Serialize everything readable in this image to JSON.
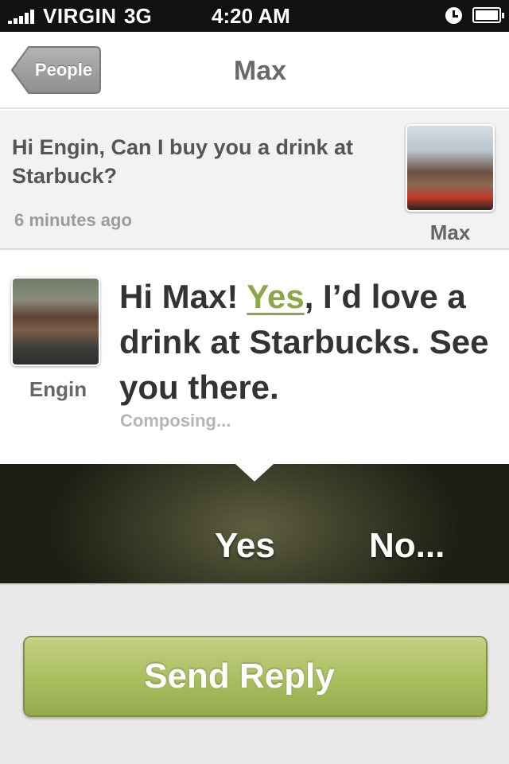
{
  "status_bar": {
    "carrier": "VIRGIN",
    "network": "3G",
    "time": "4:20 AM",
    "icons": [
      "signal-icon",
      "alarm-icon",
      "battery-icon"
    ]
  },
  "nav": {
    "back_label": "People",
    "title": "Max"
  },
  "incoming_message": {
    "text": "Hi Engin, Can I buy you a drink at Starbuck?",
    "time": "6 minutes ago",
    "sender_name": "Max"
  },
  "reply": {
    "sender_name": "Engin",
    "text_before": "Hi Max! ",
    "highlight": "Yes",
    "text_after": ", I’d love a drink at Starbucks. See you there.",
    "status": "Composing..."
  },
  "choices": {
    "yes_label": "Yes",
    "no_label": "No..."
  },
  "send_button_label": "Send Reply",
  "colors": {
    "accent_green": "#8da64a",
    "button_green": "#a9be5f",
    "choice_bar": "#3f402a",
    "status_bar": "#111111"
  }
}
